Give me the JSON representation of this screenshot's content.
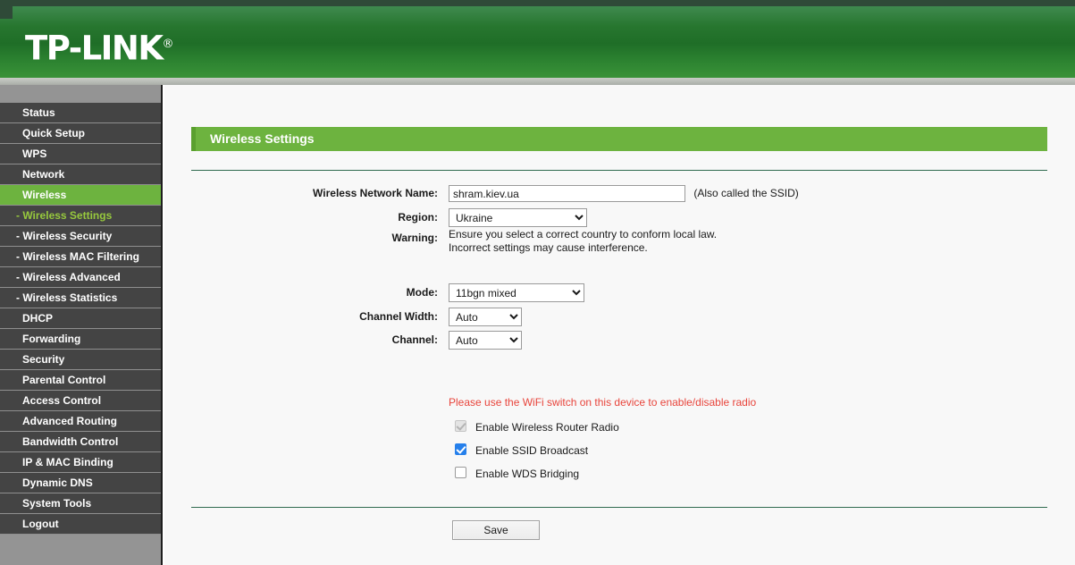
{
  "header": {
    "brand": "TP-LINK",
    "trademark": "®"
  },
  "sidebar": {
    "items": [
      {
        "label": "Status",
        "level": "top",
        "state": "normal"
      },
      {
        "label": "Quick Setup",
        "level": "top",
        "state": "normal"
      },
      {
        "label": "WPS",
        "level": "top",
        "state": "normal"
      },
      {
        "label": "Network",
        "level": "top",
        "state": "normal"
      },
      {
        "label": "Wireless",
        "level": "top",
        "state": "active-parent"
      },
      {
        "label": "- Wireless Settings",
        "level": "sub",
        "state": "active-sub"
      },
      {
        "label": "- Wireless Security",
        "level": "sub",
        "state": "normal"
      },
      {
        "label": "- Wireless MAC Filtering",
        "level": "sub",
        "state": "normal"
      },
      {
        "label": "- Wireless Advanced",
        "level": "sub",
        "state": "normal"
      },
      {
        "label": "- Wireless Statistics",
        "level": "sub",
        "state": "normal"
      },
      {
        "label": "DHCP",
        "level": "top",
        "state": "normal"
      },
      {
        "label": "Forwarding",
        "level": "top",
        "state": "normal"
      },
      {
        "label": "Security",
        "level": "top",
        "state": "normal"
      },
      {
        "label": "Parental Control",
        "level": "top",
        "state": "normal"
      },
      {
        "label": "Access Control",
        "level": "top",
        "state": "normal"
      },
      {
        "label": "Advanced Routing",
        "level": "top",
        "state": "normal"
      },
      {
        "label": "Bandwidth Control",
        "level": "top",
        "state": "normal"
      },
      {
        "label": "IP & MAC Binding",
        "level": "top",
        "state": "normal"
      },
      {
        "label": "Dynamic DNS",
        "level": "top",
        "state": "normal"
      },
      {
        "label": "System Tools",
        "level": "top",
        "state": "normal"
      },
      {
        "label": "Logout",
        "level": "top",
        "state": "normal"
      }
    ]
  },
  "page": {
    "title": "Wireless Settings"
  },
  "form": {
    "ssid": {
      "label": "Wireless Network Name:",
      "value": "shram.kiev.ua",
      "hint": "(Also called the SSID)"
    },
    "region": {
      "label": "Region:",
      "value": "Ukraine",
      "options": [
        "Ukraine"
      ]
    },
    "warning": {
      "label": "Warning:",
      "line1": "Ensure you select a correct country to conform local law.",
      "line2": "Incorrect settings may cause interference."
    },
    "mode": {
      "label": "Mode:",
      "value": "11bgn mixed",
      "options": [
        "11bgn mixed"
      ]
    },
    "channel_width": {
      "label": "Channel Width:",
      "value": "Auto",
      "options": [
        "Auto"
      ]
    },
    "channel": {
      "label": "Channel:",
      "value": "Auto",
      "options": [
        "Auto"
      ]
    }
  },
  "radio_note": "Please use the WiFi switch on this device to enable/disable radio",
  "checkboxes": [
    {
      "label": "Enable Wireless Router Radio",
      "state": "disabled-checked"
    },
    {
      "label": "Enable SSID Broadcast",
      "state": "checked"
    },
    {
      "label": "Enable WDS Bridging",
      "state": "unchecked"
    }
  ],
  "actions": {
    "save_label": "Save"
  },
  "colors": {
    "brand_green": "#6db33f",
    "header_dark_green": "#1f6e27",
    "sidebar_dark": "#444444",
    "active_sub_text": "#97c93d",
    "warning_red": "#e8453c",
    "checkbox_blue": "#2680eb"
  }
}
